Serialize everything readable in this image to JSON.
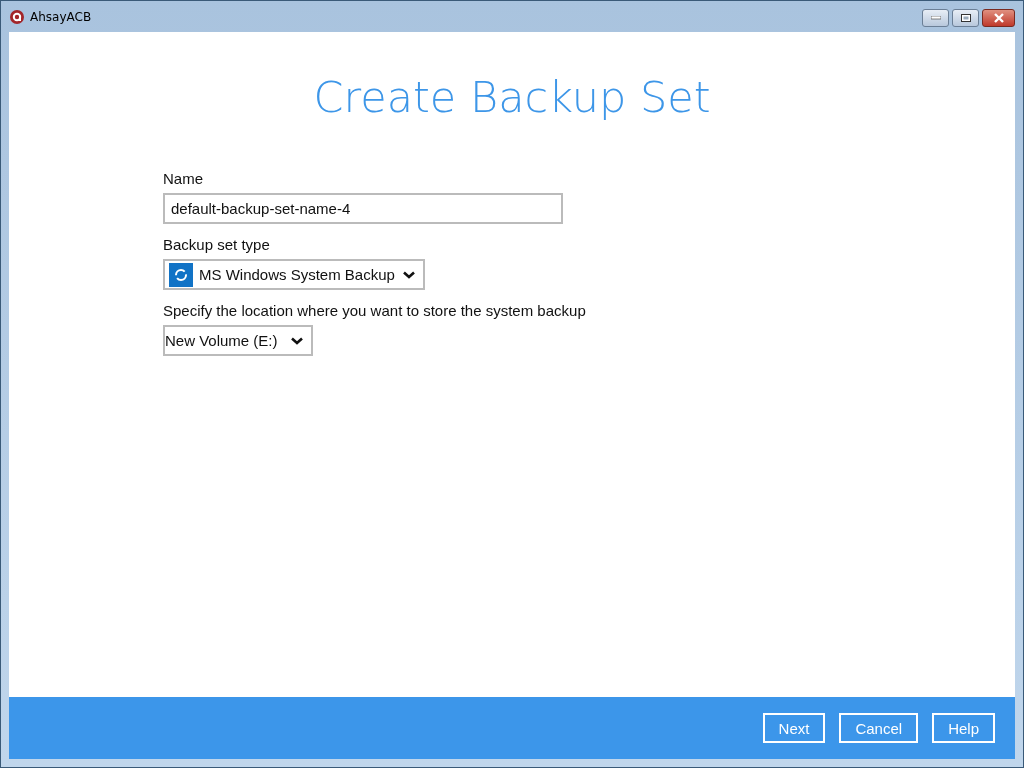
{
  "window": {
    "title": "AhsayACB"
  },
  "heading": "Create Backup Set",
  "fields": [
    {
      "kind": "text",
      "label": "Name",
      "value": "default-backup-set-name-4"
    },
    {
      "kind": "select",
      "label": "Backup set type",
      "value": "MS Windows System Backup",
      "icon": true
    },
    {
      "kind": "select",
      "label": "Specify the location where you want to store the system backup",
      "value": "New Volume (E:)",
      "icon": false
    }
  ],
  "buttons": [
    "Next",
    "Cancel",
    "Help"
  ]
}
